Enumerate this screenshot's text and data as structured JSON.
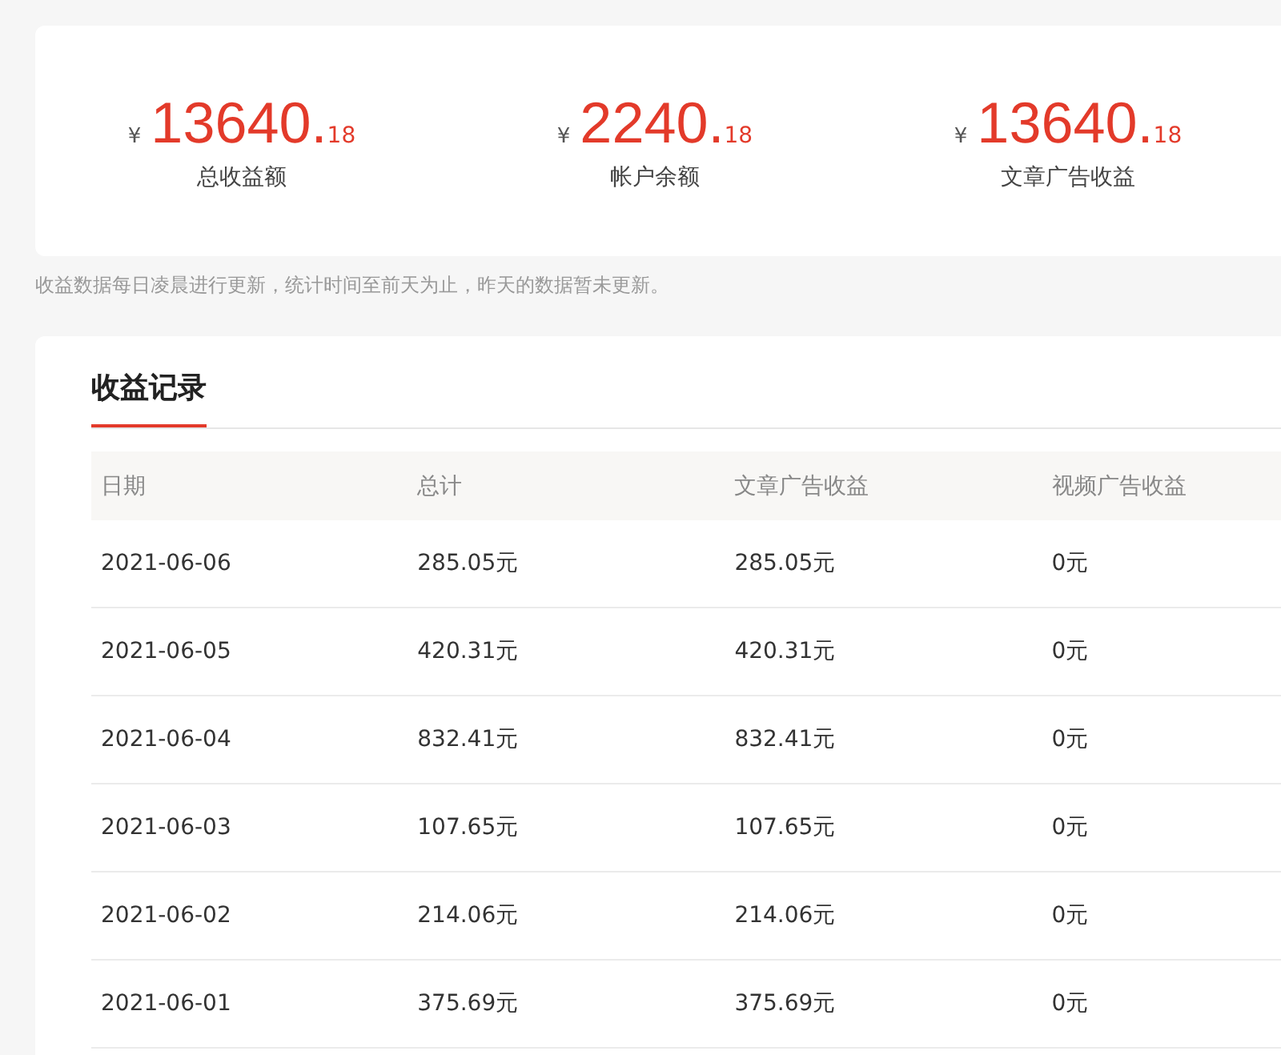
{
  "summary": [
    {
      "currency": "¥",
      "integer": "13640.",
      "decimal": "18",
      "label": "总收益额"
    },
    {
      "currency": "¥",
      "integer": "2240.",
      "decimal": "18",
      "label": "帐户余额"
    },
    {
      "currency": "¥",
      "integer": "13640.",
      "decimal": "18",
      "label": "文章广告收益"
    }
  ],
  "note": "收益数据每日凌晨进行更新，统计时间至前天为止，昨天的数据暂未更新。",
  "records": {
    "tab": {
      "label": "收益记录",
      "selected": true
    },
    "columns": [
      "日期",
      "总计",
      "文章广告收益",
      "视频广告收益"
    ],
    "rows": [
      [
        "2021-06-06",
        "285.05元",
        "285.05元",
        "0元"
      ],
      [
        "2021-06-05",
        "420.31元",
        "420.31元",
        "0元"
      ],
      [
        "2021-06-04",
        "832.41元",
        "832.41元",
        "0元"
      ],
      [
        "2021-06-03",
        "107.65元",
        "107.65元",
        "0元"
      ],
      [
        "2021-06-02",
        "214.06元",
        "214.06元",
        "0元"
      ],
      [
        "2021-06-01",
        "375.69元",
        "375.69元",
        "0元"
      ]
    ]
  }
}
